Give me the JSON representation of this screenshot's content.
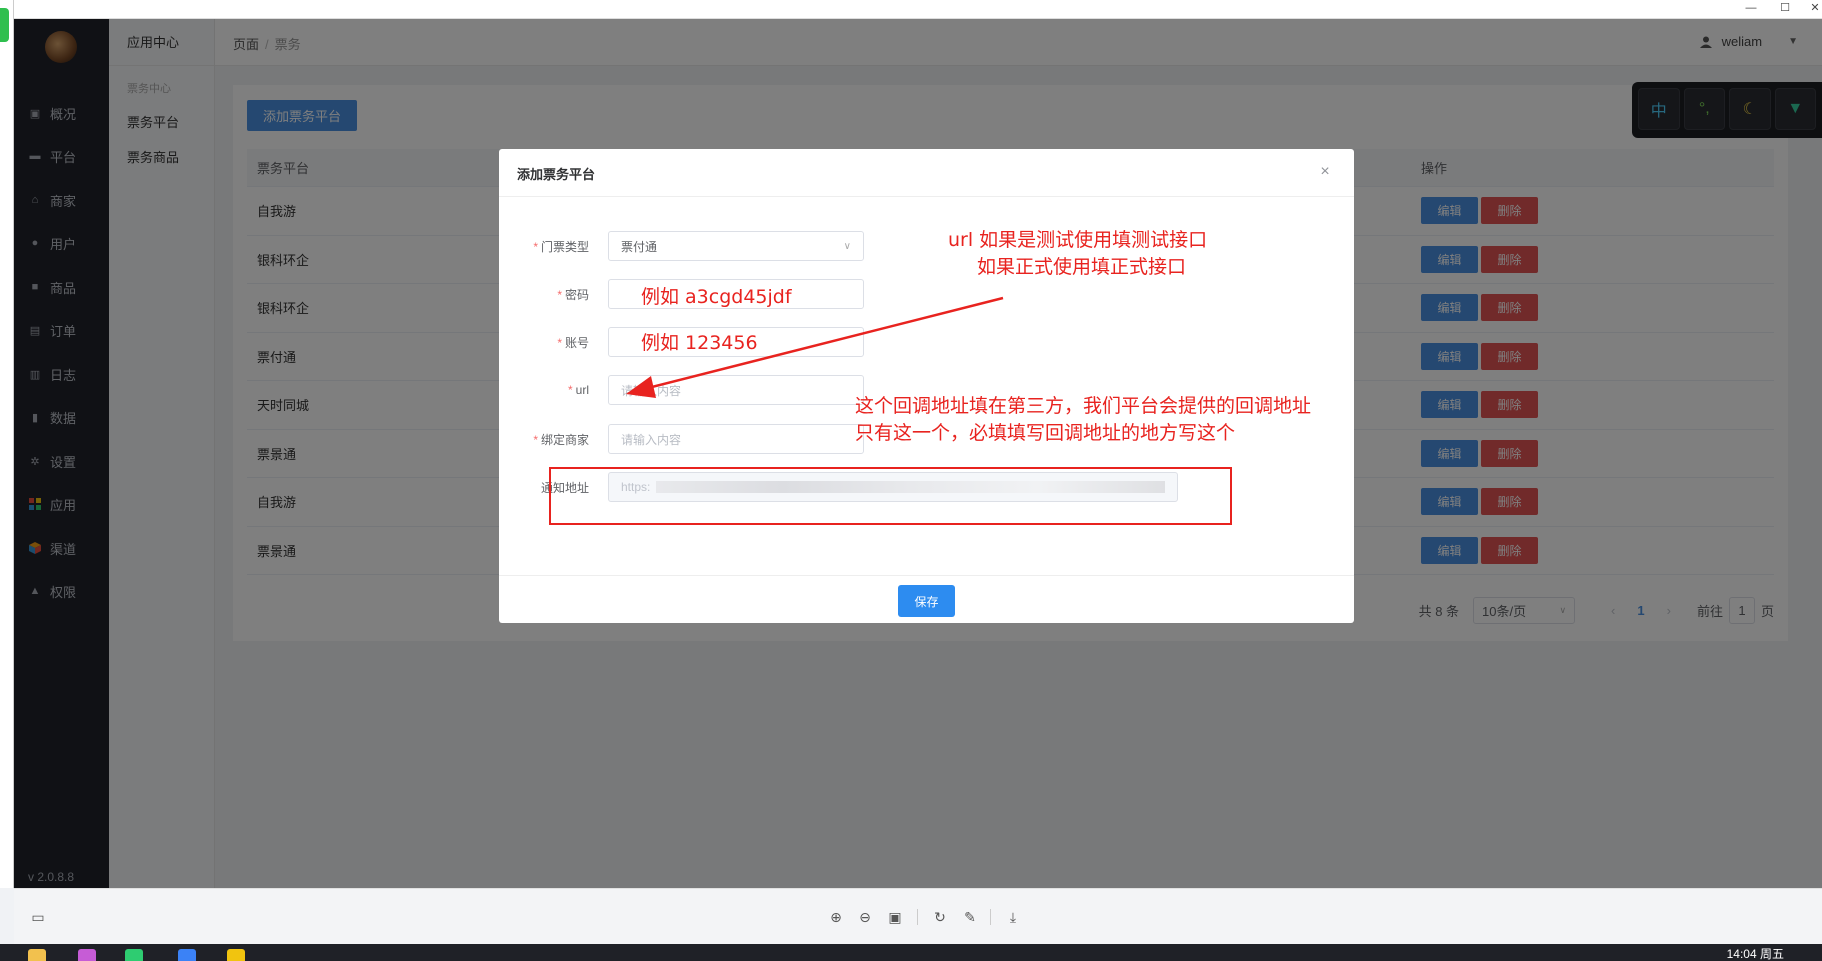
{
  "sidebar": {
    "items": [
      {
        "label": "概况",
        "icon": "dashboard-icon"
      },
      {
        "label": "平台",
        "icon": "monitor-icon"
      },
      {
        "label": "商家",
        "icon": "shop-icon"
      },
      {
        "label": "用户",
        "icon": "user-icon"
      },
      {
        "label": "商品",
        "icon": "goods-icon"
      },
      {
        "label": "订单",
        "icon": "clipboard-icon"
      },
      {
        "label": "日志",
        "icon": "log-icon"
      },
      {
        "label": "数据",
        "icon": "bar-chart-icon"
      },
      {
        "label": "设置",
        "icon": "gear-icon"
      },
      {
        "label": "应用",
        "icon": "apps-grid-icon"
      },
      {
        "label": "渠道",
        "icon": "cube-icon"
      },
      {
        "label": "权限",
        "icon": "lock-icon"
      }
    ],
    "version": "v 2.0.8.8"
  },
  "subbar": {
    "title": "应用中心",
    "group": "票务中心",
    "items": [
      "票务平台",
      "票务商品"
    ]
  },
  "header": {
    "breadcrumb_root": "页面",
    "breadcrumb_sep": "/",
    "breadcrumb_current": "票务",
    "username": "weliam"
  },
  "toolbar": {
    "add_label": "添加票务平台"
  },
  "table": {
    "col_platform": "票务平台",
    "col_actions": "操作",
    "edit_label": "编辑",
    "delete_label": "删除",
    "rows": [
      "自我游",
      "银科环企",
      "银科环企",
      "票付通",
      "天时同城",
      "票景通",
      "自我游",
      "票景通"
    ]
  },
  "pagination": {
    "total": "共 8 条",
    "page_size": "10条/页",
    "prev": "‹",
    "current": "1",
    "next": "›",
    "goto_prefix": "前往",
    "goto_value": "1",
    "goto_suffix": "页"
  },
  "dialog": {
    "title": "添加票务平台",
    "close": "×",
    "fields": {
      "ticket_type_label": "门票类型",
      "ticket_type_value": "票付通",
      "password_label": "密码",
      "account_label": "账号",
      "url_label": "url",
      "url_placeholder": "请输入内容",
      "merchant_label": "绑定商家",
      "merchant_placeholder": "请输入内容",
      "notify_label": "通知地址",
      "notify_value": "https:"
    },
    "save_label": "保存"
  },
  "annotations": {
    "password_example": "例如 a3cgd45jdf",
    "account_example": "例如 123456",
    "url_note_line1": "url 如果是测试使用填测试接口",
    "url_note_line2": "如果正式使用填正式接口",
    "notify_note_line1": "这个回调地址填在第三方，我们平台会提供的回调地址",
    "notify_note_line2": "只有这一个，必填填写回调地址的地方写这个"
  },
  "float_toolbar": {
    "key1": "中"
  },
  "taskbar": {
    "clock": "14:04 周五"
  },
  "colors": {
    "primary": "#4a90e2",
    "danger": "#e25555",
    "annotation": "#e8231f",
    "sidebar_bg": "#20232b"
  }
}
